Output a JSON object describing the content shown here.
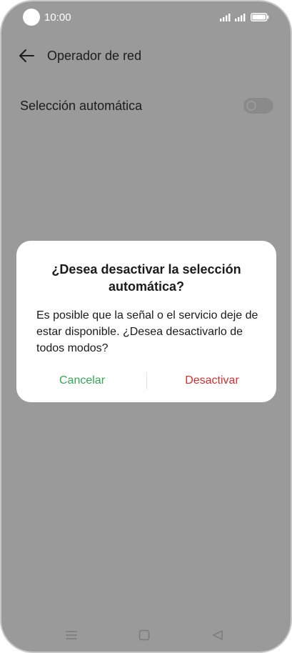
{
  "status_bar": {
    "time": "10:00"
  },
  "header": {
    "title": "Operador de red"
  },
  "settings": {
    "auto_selection_label": "Selección automática",
    "auto_selection_enabled": false
  },
  "dialog": {
    "title": "¿Desea desactivar la selección automática?",
    "message": "Es posible que la señal o el servicio deje de estar disponible. ¿Desea desactivarlo de todos modos?",
    "cancel_label": "Cancelar",
    "confirm_label": "Desactivar"
  },
  "colors": {
    "cancel": "#34a853",
    "confirm": "#d32f2f",
    "scrim_background": "#9a9a9a"
  },
  "icons": {
    "status": [
      "camera-cutout",
      "signal-icon",
      "signal-icon",
      "battery-icon"
    ],
    "header": [
      "back-arrow-icon"
    ],
    "navigation": [
      "menu-icon",
      "home-icon",
      "back-triangle-icon"
    ]
  }
}
